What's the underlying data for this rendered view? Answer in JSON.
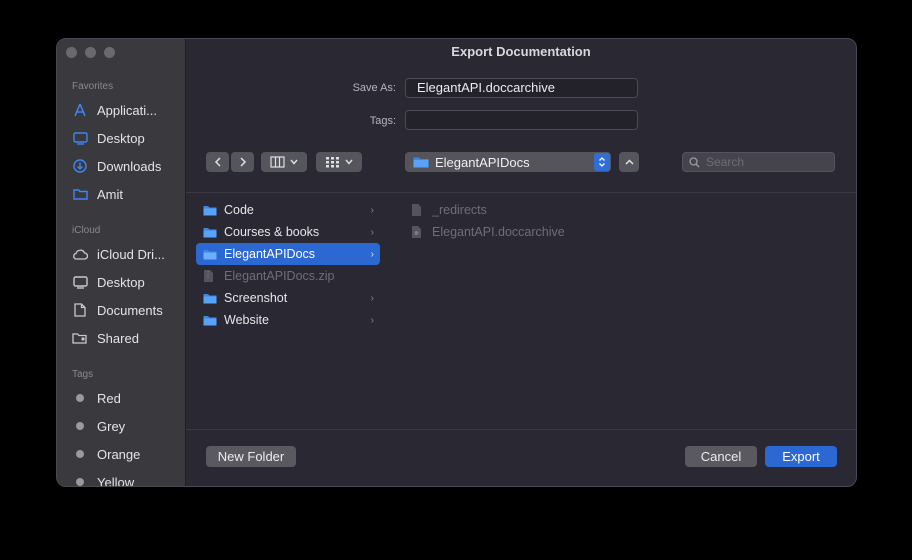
{
  "window": {
    "title": "Export Documentation"
  },
  "sidebar": {
    "favorites_heading": "Favorites",
    "favorites": [
      {
        "label": "Applicati...",
        "icon": "applications-icon"
      },
      {
        "label": "Desktop",
        "icon": "desktop-icon"
      },
      {
        "label": "Downloads",
        "icon": "downloads-icon"
      },
      {
        "label": "Amit",
        "icon": "folder-icon"
      }
    ],
    "icloud_heading": "iCloud",
    "icloud": [
      {
        "label": "iCloud Dri...",
        "icon": "cloud-icon"
      },
      {
        "label": "Desktop",
        "icon": "desktop-icon"
      },
      {
        "label": "Documents",
        "icon": "document-icon"
      },
      {
        "label": "Shared",
        "icon": "shared-folder-icon"
      }
    ],
    "tags_heading": "Tags",
    "tags": [
      {
        "label": "Red"
      },
      {
        "label": "Grey"
      },
      {
        "label": "Orange"
      },
      {
        "label": "Yellow"
      }
    ]
  },
  "form": {
    "save_as_label": "Save As:",
    "save_as_value": "ElegantAPI.doccarchive",
    "tags_label": "Tags:",
    "tags_value": ""
  },
  "toolbar": {
    "location": "ElegantAPIDocs",
    "search_placeholder": "Search"
  },
  "browser": {
    "column1": [
      {
        "name": "Code",
        "type": "folder",
        "has_children": true
      },
      {
        "name": "Courses & books",
        "type": "folder",
        "has_children": true
      },
      {
        "name": "ElegantAPIDocs",
        "type": "folder",
        "has_children": true,
        "selected": true
      },
      {
        "name": "ElegantAPIDocs.zip",
        "type": "file",
        "has_children": false,
        "disabled": true
      },
      {
        "name": "Screenshot",
        "type": "folder",
        "has_children": true
      },
      {
        "name": "Website",
        "type": "folder",
        "has_children": true
      }
    ],
    "column2": [
      {
        "name": "_redirects",
        "type": "file",
        "disabled": true
      },
      {
        "name": "ElegantAPI.doccarchive",
        "type": "file",
        "disabled": true
      }
    ]
  },
  "buttons": {
    "new_folder": "New Folder",
    "cancel": "Cancel",
    "export": "Export"
  },
  "colors": {
    "accent": "#2b68d1",
    "window_bg": "#2a2833",
    "sidebar_bg": "#3a3a3e"
  }
}
